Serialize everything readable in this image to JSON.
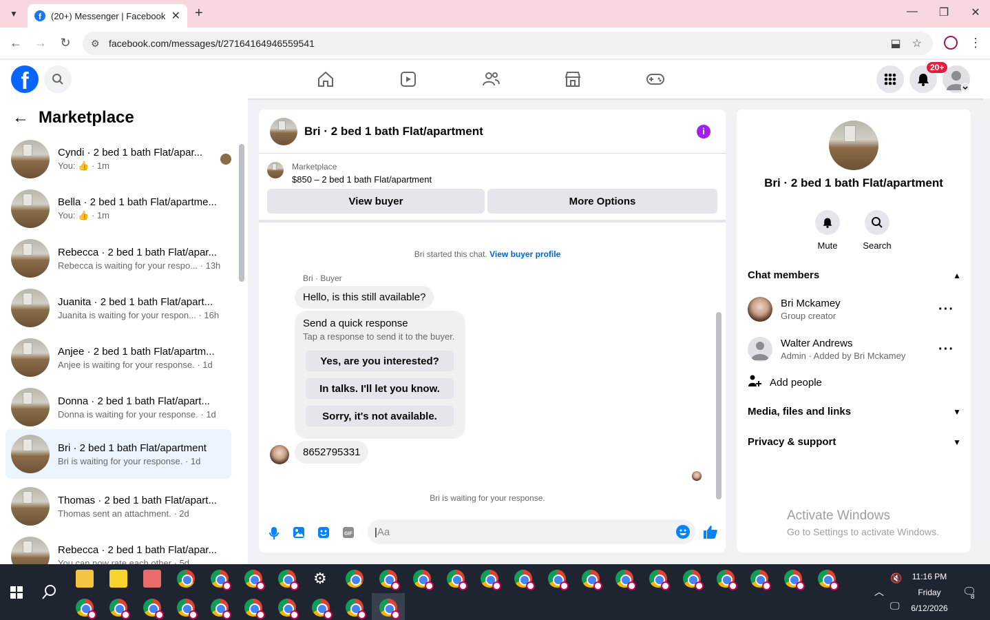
{
  "browser": {
    "tab_title": "(20+) Messenger | Facebook",
    "url": "facebook.com/messages/t/27164164946559541"
  },
  "fb_header": {
    "notif_badge": "20+"
  },
  "left": {
    "title": "Marketplace",
    "conversations": [
      {
        "name": "Cyndi · 2 bed 1 bath Flat/apar...",
        "sub_prefix": "You:",
        "sub_suffix": "· 1m"
      },
      {
        "name": "Bella · 2 bed 1 bath Flat/apartme...",
        "sub_prefix": "You:",
        "sub_suffix": "· 1m"
      },
      {
        "name": "Rebecca · 2 bed 1 bath Flat/apar...",
        "sub": "Rebecca is waiting for your respo... · 13h"
      },
      {
        "name": "Juanita · 2 bed 1 bath Flat/apart...",
        "sub": "Juanita is waiting for your respon... · 16h"
      },
      {
        "name": "Anjee · 2 bed 1 bath Flat/apartm...",
        "sub": "Anjee is waiting for your response. · 1d"
      },
      {
        "name": "Donna · 2 bed 1 bath Flat/apart...",
        "sub": "Donna is waiting for your response. · 1d"
      },
      {
        "name": "Bri · 2 bed 1 bath Flat/apartment",
        "sub": "Bri is waiting for your response. · 1d"
      },
      {
        "name": "Thomas · 2 bed 1 bath Flat/apart...",
        "sub": "Thomas sent an attachment. · 2d"
      },
      {
        "name": "Rebecca · 2 bed 1 bath Flat/apar...",
        "sub": "You can now rate each other · 5d"
      }
    ]
  },
  "chat": {
    "title": "Bri · 2 bed 1 bath Flat/apartment",
    "listing_label": "Marketplace",
    "listing_desc": "$850 – 2 bed 1 bath Flat/apartment",
    "view_buyer": "View buyer",
    "more_options": "More Options",
    "started_text": "Bri started this chat.",
    "view_profile": "View buyer profile",
    "sender": "Bri · Buyer",
    "msg1": "Hello, is this still available?",
    "quick_title": "Send a quick response",
    "quick_sub": "Tap a response to send it to the buyer.",
    "quick_options": [
      "Yes, are you interested?",
      "In talks. I'll let you know.",
      "Sorry, it's not available."
    ],
    "msg2": "8652795331",
    "waiting": "Bri is waiting for your response.",
    "input_placeholder": "Aa"
  },
  "right": {
    "title": "Bri · 2 bed 1 bath Flat/apartment",
    "mute": "Mute",
    "search": "Search",
    "chat_members": "Chat members",
    "members": [
      {
        "name": "Bri Mckamey",
        "role": "Group creator"
      },
      {
        "name": "Walter Andrews",
        "role": "Admin · Added by Bri Mckamey"
      }
    ],
    "add_people": "Add people",
    "media": "Media, files and links",
    "privacy": "Privacy & support",
    "activate_title": "Activate Windows",
    "activate_sub": "Go to Settings to activate Windows."
  },
  "taskbar": {
    "time": "11:16 PM",
    "day": "Friday",
    "date": "6/12/2026",
    "notif_count": "8"
  }
}
